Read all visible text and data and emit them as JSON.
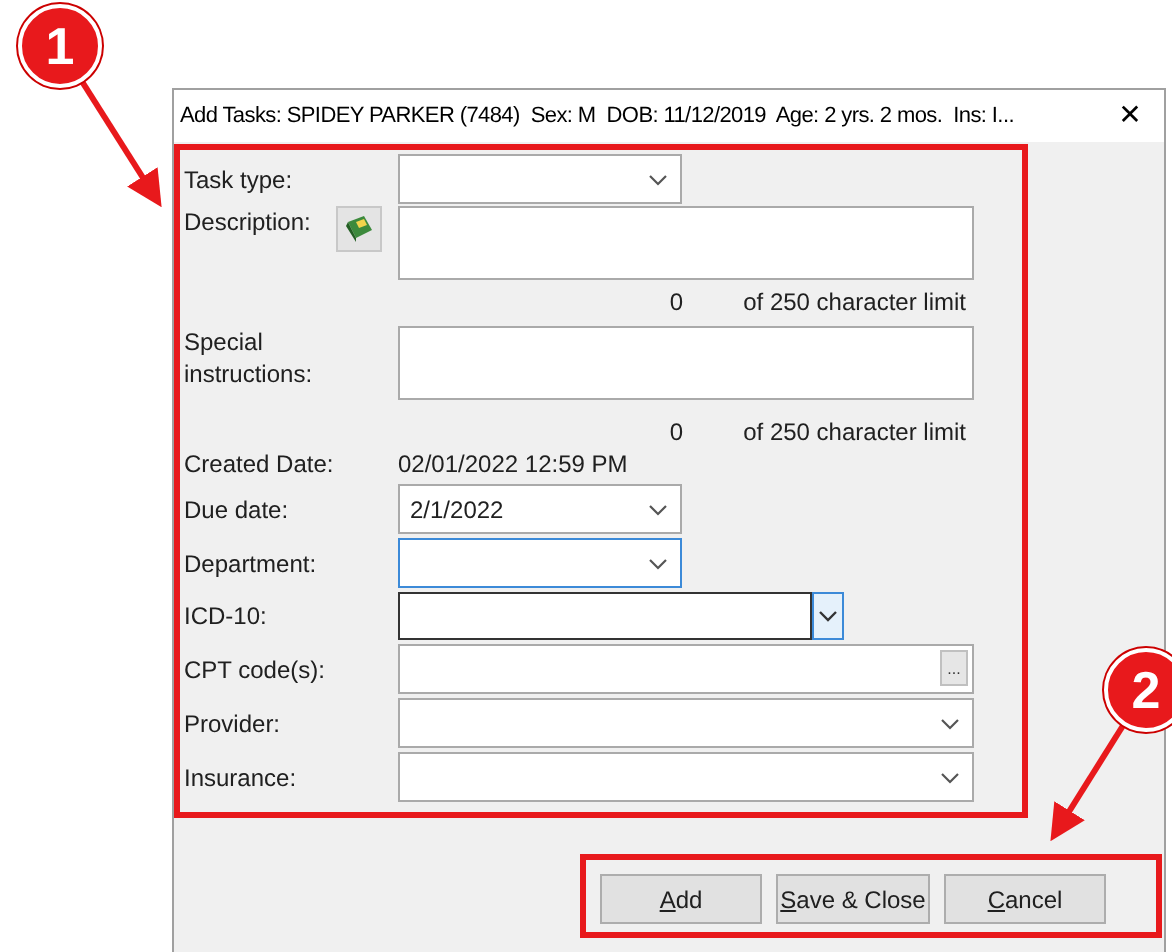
{
  "window": {
    "title": "Add Tasks: SPIDEY PARKER (7484)  Sex: M  DOB: 11/12/2019  Age: 2 yrs. 2 mos.  Ins: I...",
    "close": "✕"
  },
  "form": {
    "fields": [
      {
        "kind": "dropdown",
        "label": "Task type:",
        "focused": false
      },
      {
        "kind": "textarea_with_button",
        "label": "Description:"
      },
      {
        "kind": "counter",
        "count": "0",
        "limit": "of 250 character limit"
      },
      {
        "kind": "textarea",
        "label": "Special instructions:"
      },
      {
        "kind": "counter",
        "count": "0",
        "limit": "of 250 character limit"
      },
      {
        "kind": "static",
        "label": "Created Date:",
        "value": "02/01/2022 12:59 PM"
      },
      {
        "kind": "dropdown",
        "label": "Due date:",
        "value": "2/1/2022",
        "focused": false
      },
      {
        "kind": "dropdown",
        "label": "Department:",
        "focused": true
      },
      {
        "kind": "combo",
        "label": "ICD-10:"
      },
      {
        "kind": "lookup",
        "label": "CPT code(s):",
        "button": "..."
      },
      {
        "kind": "wide_dropdown",
        "label": "Provider:",
        "focused": false
      },
      {
        "kind": "wide_dropdown",
        "label": "Insurance:",
        "focused": false
      }
    ]
  },
  "buttons": [
    {
      "label": "Add",
      "accelerator": true
    },
    {
      "label": "Save & Close",
      "accelerator": true
    },
    {
      "label": "Cancel",
      "accelerator": true
    }
  ],
  "annotations": [
    {
      "label": "1",
      "color": "#e8191c"
    },
    {
      "label": "2",
      "color": "#e8191c"
    }
  ]
}
